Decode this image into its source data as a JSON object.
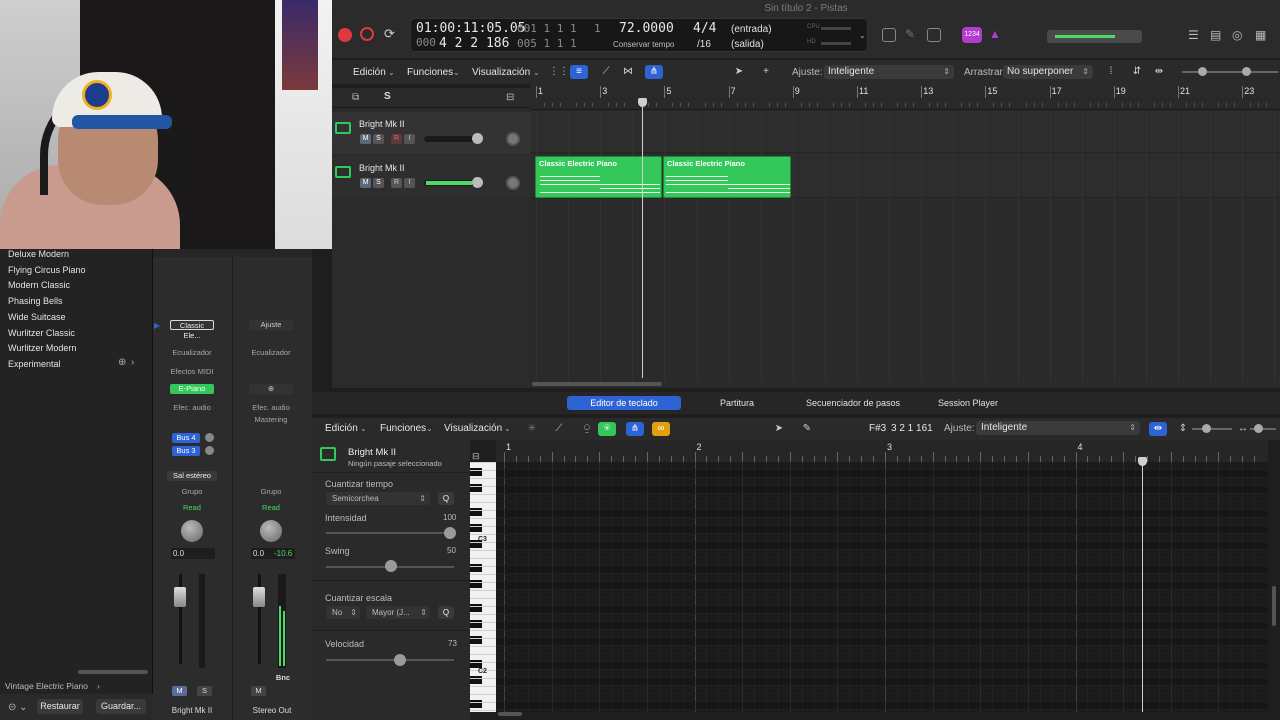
{
  "window": {
    "title": "Sin título 2 - Pistas"
  },
  "transport": {
    "timecode": "01:00:11:05.05",
    "bars_beats": "4 2 2 186",
    "timecode_dim": "001 1 1 1",
    "bars_dim": "005 1 1 1",
    "left_bottom_dim": "000",
    "right_bottom_dim": "1",
    "tempo": "72.0000",
    "tempo_mode": "Conservar tempo",
    "signature": "4/4",
    "division": "/16",
    "input": "(entrada)",
    "output": "(salida)",
    "cpu": "CPU",
    "hd": "HD",
    "count_badge": "1234"
  },
  "arrange_toolbar": {
    "edit": "Edición",
    "functions": "Funciones",
    "view": "Visualización",
    "snap_label": "Ajuste:",
    "snap_value": "Inteligente",
    "drag_label": "Arrastrar:",
    "drag_value": "No superponer",
    "s_button": "S"
  },
  "ruler": [
    "1",
    "3",
    "5",
    "7",
    "9",
    "11",
    "13",
    "15",
    "17",
    "19",
    "21",
    "23"
  ],
  "tracks": [
    {
      "name": "Bright Mk II",
      "m": "M",
      "s": "S",
      "r": "R",
      "i": "I"
    },
    {
      "name": "Bright Mk II",
      "m": "M",
      "s": "S",
      "r": "R",
      "i": "I"
    }
  ],
  "regions": [
    {
      "label": "Classic Electric Piano"
    },
    {
      "label": "Classic Electric Piano"
    }
  ],
  "library": {
    "items": [
      "Deluxe Modern",
      "Flying Circus Piano",
      "Modern Classic",
      "Phasing Bells",
      "Wide Suitcase",
      "Wurlitzer Classic",
      "Wurlitzer Modern",
      "Experimental"
    ],
    "footer_patch": "Vintage Electric Piano",
    "restore": "Restaurar",
    "save": "Guardar..."
  },
  "strip1": {
    "setting": "Classic Ele...",
    "eq": "Ecualizador",
    "midi_fx": "Efectos MIDI",
    "instrument": "E-Piano",
    "audio_fx": "Efec. audio",
    "send1": "Bus 4",
    "send2": "Bus 3",
    "output": "Sal estéreo",
    "group": "Grupo",
    "automation": "Read",
    "volume": "0.0",
    "mute": "M",
    "solo": "S",
    "name": "Bright Mk II"
  },
  "strip2": {
    "setting": "Ajuste",
    "eq": "Ecualizador",
    "audio_fx": "Efec. audio",
    "mastering": "Mastering",
    "group": "Grupo",
    "automation": "Read",
    "volume": "0.0",
    "peak": "-10.6",
    "mute": "M",
    "bounce": "Bnc",
    "name": "Stereo Out"
  },
  "editor_tabs": [
    "Editor de teclado",
    "Partitura",
    "Secuenciador de pasos",
    "Session Player"
  ],
  "editor_toolbar": {
    "edit": "Edición",
    "functions": "Funciones",
    "view": "Visualización",
    "position_note": "F#3",
    "position_time": "3 2 1 161",
    "snap_label": "Ajuste:",
    "snap_value": "Inteligente"
  },
  "editor_inspector": {
    "track_name": "Bright Mk II",
    "region_status": "Ningún pasaje seleccionado",
    "quantize_time": "Cuantizar tiempo",
    "quantize_value": "Semicorchea",
    "q_button": "Q",
    "strength": "Intensidad",
    "strength_value": "100",
    "swing": "Swing",
    "swing_value": "50",
    "scale_quantize": "Cuantizar escala",
    "scale_on": "No",
    "scale_type": "Mayor (J...",
    "velocity": "Velocidad",
    "velocity_value": "73"
  },
  "piano_roll_ruler": [
    "1",
    "2",
    "3",
    "4"
  ],
  "piano_labels": {
    "c3": "C3",
    "c2": "C2"
  },
  "colors": {
    "region": "#34c759",
    "accent": "#2e63d6",
    "record": "#e0383e"
  }
}
